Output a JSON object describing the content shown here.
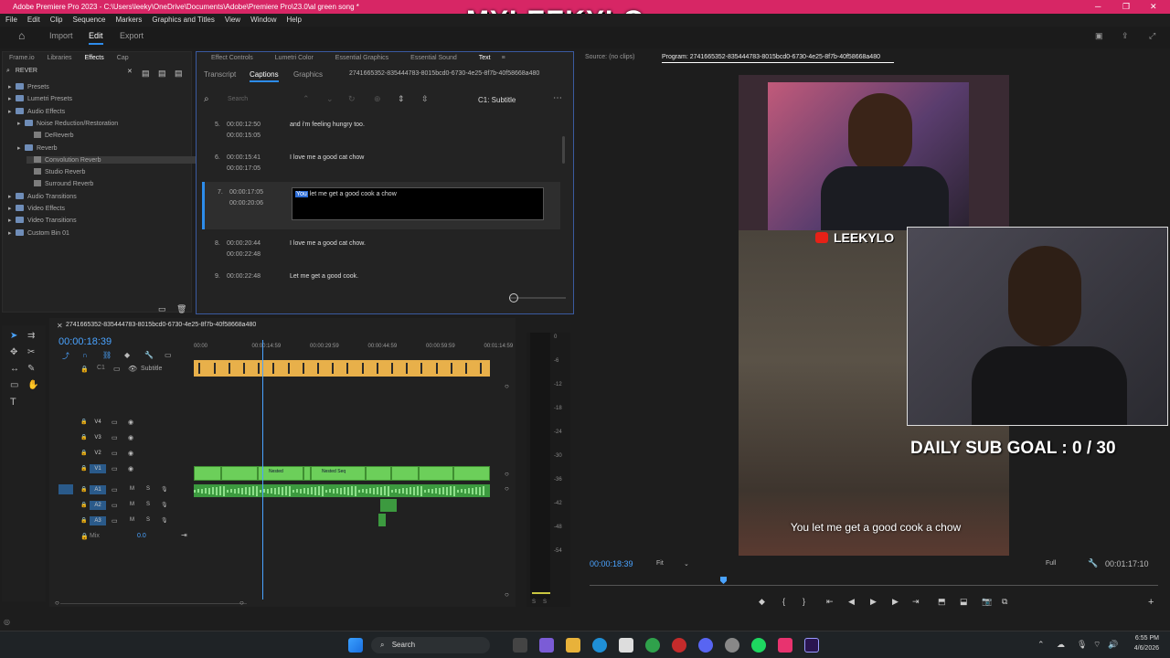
{
  "window": {
    "title": "Adobe Premiere Pro 2023 - C:\\Users\\leeky\\OneDrive\\Documents\\Adobe\\Premiere Pro\\23.0\\al green song *"
  },
  "watermark": "MYLEEKYLO",
  "menu": [
    "File",
    "Edit",
    "Clip",
    "Sequence",
    "Markers",
    "Graphics and Titles",
    "View",
    "Window",
    "Help"
  ],
  "workspace": {
    "import": "Import",
    "edit": "Edit",
    "export": "Export"
  },
  "effects_panel": {
    "tabs": [
      "Frame.io",
      "Libraries",
      "Effects",
      "Cap"
    ],
    "search_value": "REVER",
    "tree": [
      {
        "label": "Presets",
        "indent": 0
      },
      {
        "label": "Lumetri Presets",
        "indent": 0
      },
      {
        "label": "Audio Effects",
        "indent": 0
      },
      {
        "label": "Noise Reduction/Restoration",
        "indent": 1
      },
      {
        "label": "DeReverb",
        "indent": 2
      },
      {
        "label": "Reverb",
        "indent": 1
      },
      {
        "label": "Convolution Reverb",
        "indent": 2
      },
      {
        "label": "Studio Reverb",
        "indent": 2
      },
      {
        "label": "Surround Reverb",
        "indent": 2
      },
      {
        "label": "Audio Transitions",
        "indent": 0
      },
      {
        "label": "Video Effects",
        "indent": 0
      },
      {
        "label": "Video Transitions",
        "indent": 0
      },
      {
        "label": "Custom Bin 01",
        "indent": 0
      }
    ]
  },
  "text_panel": {
    "top_tabs": [
      "Effect Controls",
      "Lumetri Color",
      "Essential Graphics",
      "Essential Sound",
      "Text"
    ],
    "sub_tabs": [
      "Transcript",
      "Captions",
      "Graphics"
    ],
    "sequence_id": "2741665352-835444783-8015bcd0-6730-4e25-8f7b-40f58668a480",
    "search_placeholder": "Search",
    "track_label": "C1: Subtitle",
    "captions": [
      {
        "num": "5.",
        "in": "00:00:12:50",
        "out": "00:00:15:05",
        "text": "and i'm feeling hungry too."
      },
      {
        "num": "6.",
        "in": "00:00:15:41",
        "out": "00:00:17:05",
        "text": "I love me a good cat chow"
      },
      {
        "num": "7.",
        "in": "00:00:17:05",
        "out": "00:00:20:06",
        "text": "let me get a good cook a chow",
        "highlight": "You"
      },
      {
        "num": "8.",
        "in": "00:00:20:44",
        "out": "00:00:22:48",
        "text": "I love me a good cat chow."
      },
      {
        "num": "9.",
        "in": "00:00:22:48",
        "out": "",
        "text": "Let me get a good cook."
      }
    ]
  },
  "source_monitor": {
    "label": "Source: (no clips)"
  },
  "program_monitor": {
    "title": "Program: 2741665352-835444783-8015bcd0-6730-4e25-8f7b-40f58668a480",
    "timecode": "00:00:18:39",
    "fit": "Fit",
    "full": "Full",
    "duration": "00:01:17:10",
    "caption": "You let me get a good cook a chow",
    "overlay_name": "LEEKYLO",
    "sub_goal": "DAILY SUB GOAL : 0 / 30"
  },
  "timeline": {
    "sequence_name": "2741665352-835444783-8015bcd0-6730-4e25-8f7b-40f58668a480",
    "timecode": "00:00:18:39",
    "ruler": [
      "00:00",
      "00:00:14:59",
      "00:00:29:59",
      "00:00:44:59",
      "00:00:59:59",
      "00:01:14:59"
    ],
    "subtitle_track": "Subtitle",
    "video_tracks": [
      "V4",
      "V3",
      "V2",
      "V1"
    ],
    "audio_tracks": [
      "A1",
      "A2",
      "A3"
    ],
    "mix_label": "Mix",
    "mix_value": "0.0",
    "clip_labels": [
      "Nested",
      "Nested Seq"
    ],
    "playhead_position": 0.23
  },
  "meter_scale": [
    "0",
    "-6",
    "-12",
    "-18",
    "-24",
    "-30",
    "-36",
    "-42",
    "-48",
    "-54"
  ],
  "meter_labels": [
    "S",
    "S"
  ],
  "taskbar": {
    "search": "Search",
    "time": "6:55 PM",
    "date": "4/6/2026"
  }
}
